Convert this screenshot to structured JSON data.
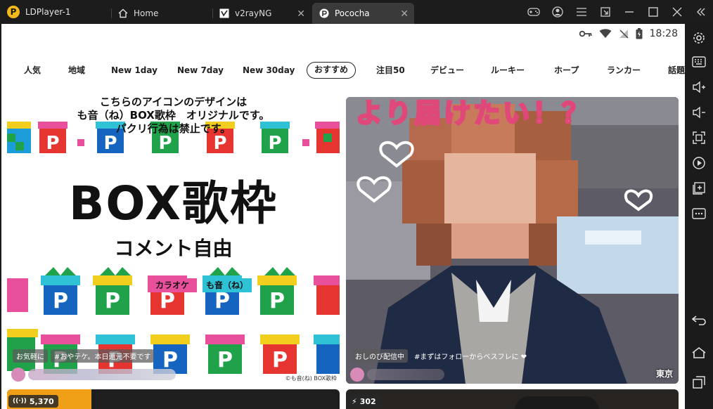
{
  "app": {
    "title": "LDPlayer-1"
  },
  "tabs": [
    {
      "label": "Home"
    },
    {
      "label": "v2rayNG"
    },
    {
      "label": "Pococha"
    }
  ],
  "status": {
    "time": "18:28"
  },
  "categories": [
    "人気",
    "地域",
    "New 1day",
    "New 7day",
    "New 30day",
    "おすすめ",
    "注目50",
    "デビュー",
    "ルーキー",
    "ホープ",
    "ランカー",
    "話題"
  ],
  "active_category": "おすすめ",
  "cards": [
    {
      "art_lines": [
        "こちらのアイコンのデザインは",
        "も音（ね）BOX歌枠　オリジナルです。",
        "パクリ行為は禁止です。"
      ],
      "big_title": "BOX歌枠",
      "subtitle": "コメント自由",
      "label_karaoke": "カラオケ",
      "label_mone": "も音（ね）",
      "credit": "©も音(ね) BOX歌枠",
      "tags": [
        "お気軽に",
        "#おやテケ。本日還元不要です"
      ]
    },
    {
      "art_heading": "より届けたい！？",
      "tags": [
        "おしのび配信中",
        "#まずはフォローからベスフレに ❤"
      ],
      "location": "東京"
    }
  ],
  "bottom_cards": [
    {
      "viewers": "5,370"
    },
    {
      "viewers": "302"
    }
  ],
  "colors": {
    "accent": "#f3b81c",
    "heart": "#e0487a"
  }
}
